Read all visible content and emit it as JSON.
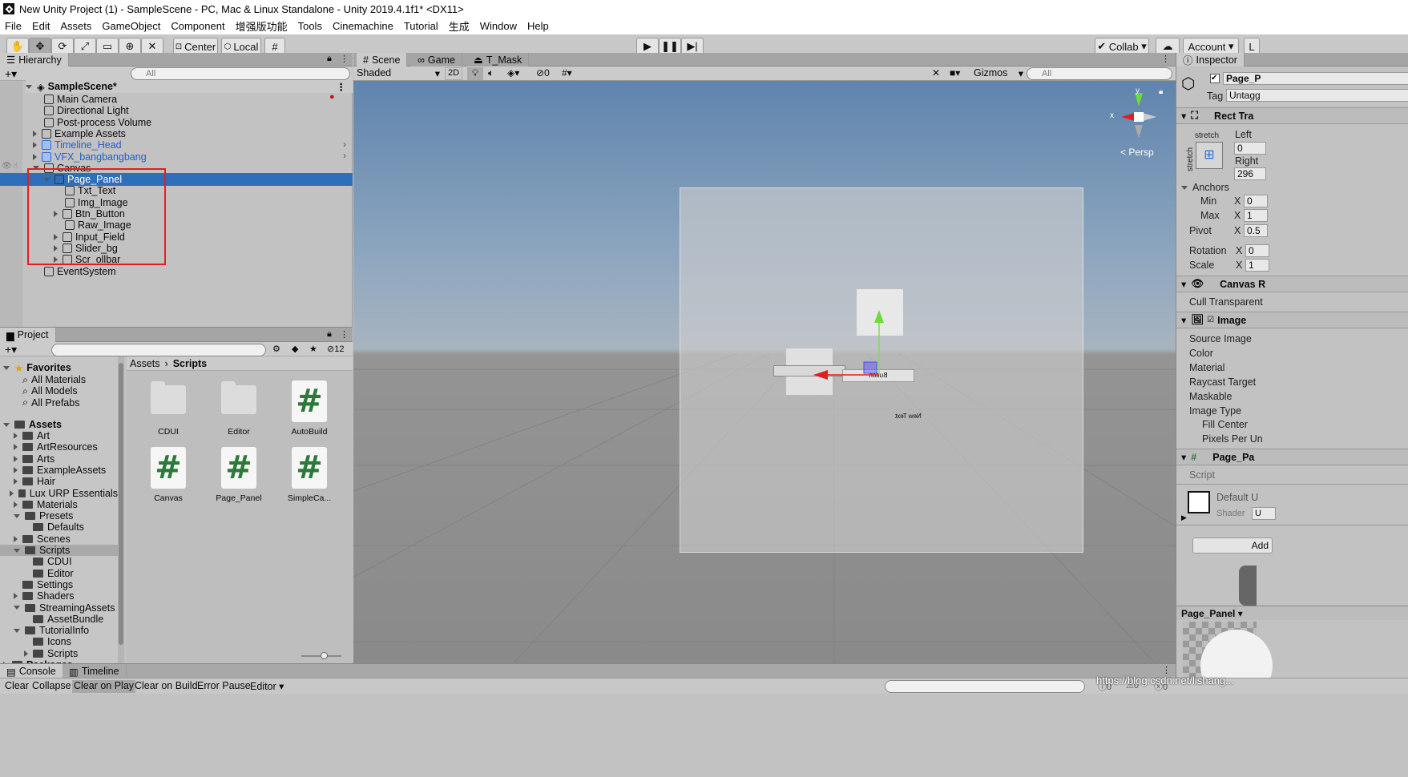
{
  "window_title": "New Unity Project (1) - SampleScene - PC, Mac & Linux Standalone - Unity 2019.4.1f1* <DX11>",
  "menu": [
    "File",
    "Edit",
    "Assets",
    "GameObject",
    "Component",
    "增强版功能",
    "Tools",
    "Cinemachine",
    "Tutorial",
    "生成",
    "Window",
    "Help"
  ],
  "toolbar": {
    "center_label": "Center",
    "local_label": "Local",
    "collab_label": "Collab",
    "account_label": "Account",
    "layers_label": "L"
  },
  "hierarchy": {
    "tab": "Hierarchy",
    "search_placeholder": "All",
    "scene": "SampleScene*",
    "items": [
      {
        "label": "Main Camera",
        "depth": 1,
        "arrow": "none",
        "blue": false
      },
      {
        "label": "Directional Light",
        "depth": 1,
        "arrow": "none",
        "blue": false
      },
      {
        "label": "Post-process Volume",
        "depth": 1,
        "arrow": "none",
        "blue": false
      },
      {
        "label": "Example Assets",
        "depth": 1,
        "arrow": "right",
        "blue": false
      },
      {
        "label": "Timeline_Head",
        "depth": 1,
        "arrow": "right",
        "blue": true
      },
      {
        "label": "VFX_bangbangbang",
        "depth": 1,
        "arrow": "right",
        "blue": true
      },
      {
        "label": "Canvas",
        "depth": 1,
        "arrow": "down",
        "blue": false
      },
      {
        "label": "Page_Panel",
        "depth": 2,
        "arrow": "down",
        "blue": false,
        "selected": true
      },
      {
        "label": "Txt_Text",
        "depth": 3,
        "arrow": "none",
        "blue": false
      },
      {
        "label": "Img_Image",
        "depth": 3,
        "arrow": "none",
        "blue": false
      },
      {
        "label": "Btn_Button",
        "depth": 3,
        "arrow": "right",
        "blue": false
      },
      {
        "label": "Raw_Image",
        "depth": 3,
        "arrow": "none",
        "blue": false
      },
      {
        "label": "Input_Field",
        "depth": 3,
        "arrow": "right",
        "blue": false
      },
      {
        "label": "Slider_bg",
        "depth": 3,
        "arrow": "right",
        "blue": false
      },
      {
        "label": "Scr_ollbar",
        "depth": 3,
        "arrow": "right",
        "blue": false
      },
      {
        "label": "EventSystem",
        "depth": 1,
        "arrow": "none",
        "blue": false
      }
    ]
  },
  "project": {
    "tab": "Project",
    "hidden_count": "12",
    "breadcrumb_root": "Assets",
    "breadcrumb_leaf": "Scripts",
    "favorites_label": "Favorites",
    "favorites": [
      "All Materials",
      "All Models",
      "All Prefabs"
    ],
    "assets_label": "Assets",
    "tree": [
      {
        "label": "Art",
        "depth": 1,
        "arrow": "right"
      },
      {
        "label": "ArtResources",
        "depth": 1,
        "arrow": "right"
      },
      {
        "label": "Arts",
        "depth": 1,
        "arrow": "right"
      },
      {
        "label": "ExampleAssets",
        "depth": 1,
        "arrow": "right"
      },
      {
        "label": "Hair",
        "depth": 1,
        "arrow": "right"
      },
      {
        "label": "Lux URP Essentials",
        "depth": 1,
        "arrow": "right"
      },
      {
        "label": "Materials",
        "depth": 1,
        "arrow": "right"
      },
      {
        "label": "Presets",
        "depth": 1,
        "arrow": "down"
      },
      {
        "label": "Defaults",
        "depth": 2,
        "arrow": "none"
      },
      {
        "label": "Scenes",
        "depth": 1,
        "arrow": "right"
      },
      {
        "label": "Scripts",
        "depth": 1,
        "arrow": "down",
        "selected": true
      },
      {
        "label": "CDUI",
        "depth": 2,
        "arrow": "none"
      },
      {
        "label": "Editor",
        "depth": 2,
        "arrow": "none"
      },
      {
        "label": "Settings",
        "depth": 1,
        "arrow": "none"
      },
      {
        "label": "Shaders",
        "depth": 1,
        "arrow": "right"
      },
      {
        "label": "StreamingAssets",
        "depth": 1,
        "arrow": "down"
      },
      {
        "label": "AssetBundle",
        "depth": 2,
        "arrow": "none"
      },
      {
        "label": "TutorialInfo",
        "depth": 1,
        "arrow": "down"
      },
      {
        "label": "Icons",
        "depth": 2,
        "arrow": "none"
      },
      {
        "label": "Scripts",
        "depth": 2,
        "arrow": "right"
      }
    ],
    "packages_label": "Packages",
    "grid": [
      {
        "label": "CDUI",
        "kind": "folder"
      },
      {
        "label": "Editor",
        "kind": "folder"
      },
      {
        "label": "AutoBuild",
        "kind": "script"
      },
      {
        "label": "Canvas",
        "kind": "script"
      },
      {
        "label": "Page_Panel",
        "kind": "script"
      },
      {
        "label": "SimpleCa...",
        "kind": "script"
      }
    ]
  },
  "scene": {
    "tabs": [
      "Scene",
      "Game",
      "T_Mask"
    ],
    "shading": "Shaded",
    "mode_2d": "2D",
    "fx_count": "0",
    "gizmos": "Gizmos",
    "search_placeholder": "All",
    "persp": "< Persp",
    "axis_y": "y",
    "axis_x": "x",
    "mirrored_button_text": "Button",
    "mirrored_text": "New Text"
  },
  "inspector": {
    "tab": "Inspector",
    "object_name": "Page_P",
    "tag_label": "Tag",
    "tag_value": "Untagg",
    "rect_transform": "Rect Tra",
    "stretch_top": "stretch",
    "stretch_side": "stretch",
    "left_label": "Left",
    "left_value": "0",
    "right_label": "Right",
    "right_value": "296",
    "anchors": "Anchors",
    "min": "Min",
    "max": "Max",
    "min_x": "0",
    "max_x": "1",
    "pivot": "Pivot",
    "pivot_x": "0.5",
    "rotation": "Rotation",
    "rotation_x": "0",
    "scale": "Scale",
    "scale_x": "1",
    "x_label": "X",
    "canvas_renderer": "Canvas R",
    "cull": "Cull Transparent",
    "image": "Image",
    "image_fields": [
      "Source Image",
      "Color",
      "Material",
      "Raycast Target",
      "Maskable",
      "Image Type"
    ],
    "fill_center": "Fill Center",
    "pixels_per": "Pixels Per Un",
    "script_comp": "Page_Pa",
    "script_label": "Script",
    "material_name": "Default U",
    "shader_label": "Shader",
    "shader_value": "U",
    "add_component": "Add",
    "preview_name": "Page_Panel"
  },
  "console": {
    "tab_console": "Console",
    "tab_timeline": "Timeline",
    "buttons": [
      "Clear",
      "Collapse",
      "Clear on Play",
      "Clear on Build",
      "Error Pause",
      "Editor"
    ],
    "count_log": "0",
    "count_warn": "0",
    "count_err": "0"
  },
  "watermark": "https://blog.csdn.net/lishang..."
}
